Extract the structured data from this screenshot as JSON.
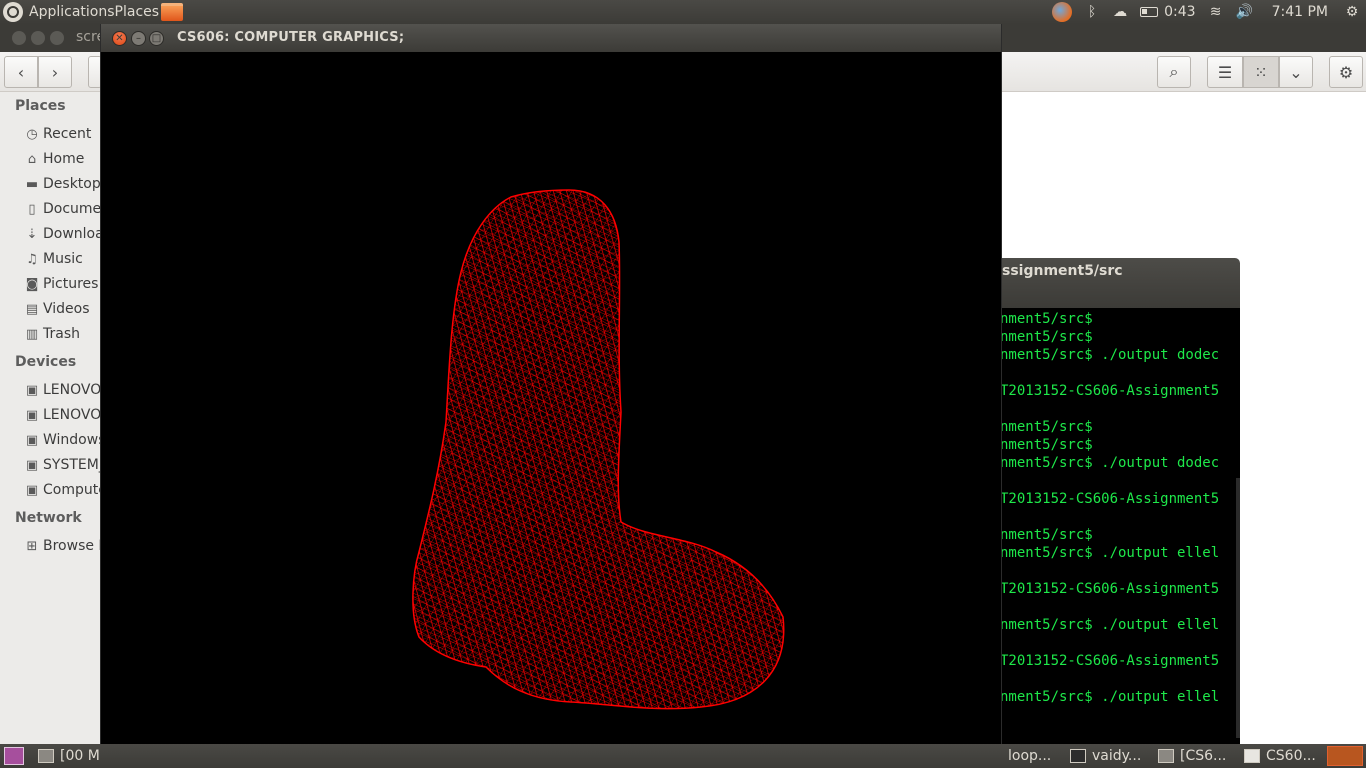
{
  "top_panel": {
    "menus": [
      "Applications",
      "Places"
    ],
    "time_remaining": "0:43",
    "clock": "7:41 PM"
  },
  "file_manager": {
    "title_fragment": "scre",
    "sidebar": {
      "places_heading": "Places",
      "places": [
        {
          "label": "Recent",
          "icon": "clock-icon"
        },
        {
          "label": "Home",
          "icon": "home-icon"
        },
        {
          "label": "Desktop",
          "icon": "folder-icon"
        },
        {
          "label": "Documents",
          "icon": "document-icon"
        },
        {
          "label": "Downloads",
          "icon": "download-icon"
        },
        {
          "label": "Music",
          "icon": "music-icon"
        },
        {
          "label": "Pictures",
          "icon": "camera-icon"
        },
        {
          "label": "Videos",
          "icon": "film-icon"
        },
        {
          "label": "Trash",
          "icon": "trash-icon"
        }
      ],
      "devices_heading": "Devices",
      "devices": [
        {
          "label": "LENOVO",
          "icon": "drive-icon"
        },
        {
          "label": "LENOVO",
          "icon": "drive-icon"
        },
        {
          "label": "Windows",
          "icon": "drive-icon"
        },
        {
          "label": "SYSTEM_",
          "icon": "drive-icon"
        },
        {
          "label": "Computer",
          "icon": "drive-icon"
        }
      ],
      "network_heading": "Network",
      "network": [
        {
          "label": "Browse N",
          "icon": "network-icon"
        }
      ]
    }
  },
  "gl_window": {
    "title": "CS606: COMPUTER GRAPHICS;",
    "mesh_color": "#ff0000"
  },
  "terminal": {
    "title_fragment": "ssignment5/src",
    "lines": [
      "nment5/src$",
      "nment5/src$",
      "nment5/src$ ./output dodec",
      "",
      "T2013152-CS606-Assignment5",
      "",
      "nment5/src$",
      "nment5/src$",
      "nment5/src$ ./output dodec",
      "",
      "T2013152-CS606-Assignment5",
      "",
      "nment5/src$",
      "nment5/src$ ./output ellel",
      "",
      "T2013152-CS606-Assignment5",
      "",
      "nment5/src$ ./output ellel",
      "",
      "T2013152-CS606-Assignment5",
      "",
      "nment5/src$ ./output ellel"
    ],
    "text_color": "#1ee84a"
  },
  "bottom_panel": {
    "tasks": [
      "[00 M",
      "loop...",
      "vaidy...",
      "[CS6...",
      "CS60..."
    ]
  }
}
